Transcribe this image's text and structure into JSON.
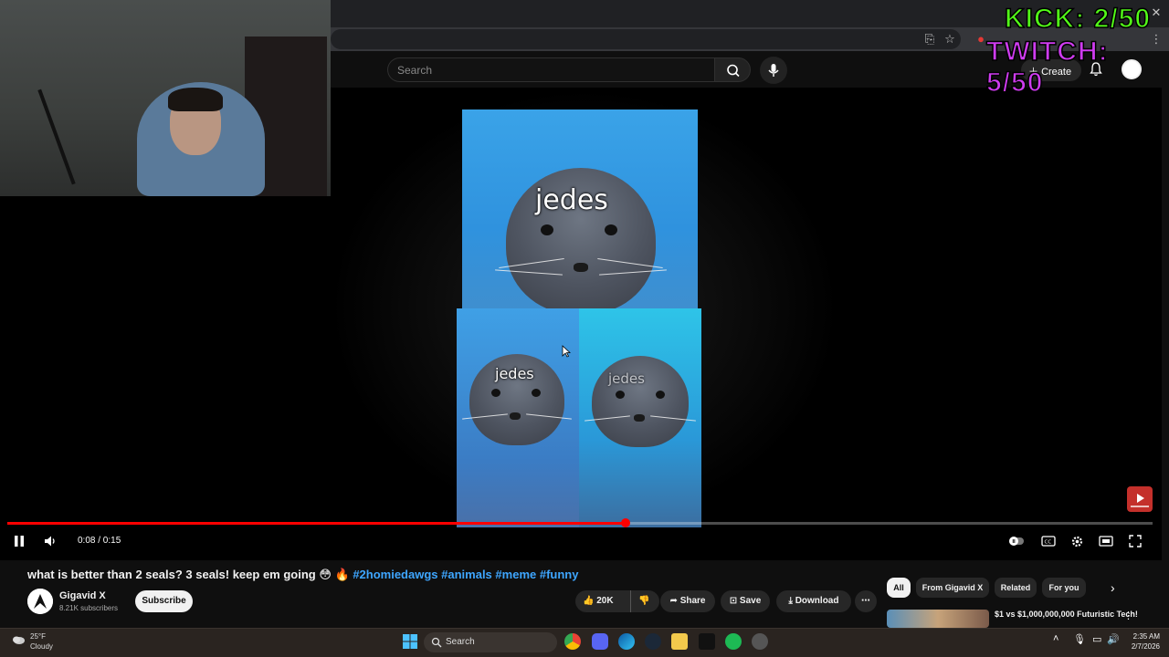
{
  "browser": {
    "icons": [
      "install-icon",
      "star-icon",
      "extension-icon",
      "extension-icon",
      "extension-icon",
      "puzzle-icon",
      "menu-dots-icon"
    ]
  },
  "header": {
    "search_placeholder": "Search",
    "create_label": "Create"
  },
  "overlays": {
    "kick_counter": "KICK: 2/50",
    "twitch_counter": "TWITCH: 5/50",
    "kick_color": "#53fc18",
    "twitch_color": "#cf3cf0"
  },
  "video_frame": {
    "caption_top": "jedes",
    "caption_left": "jedes",
    "caption_right": "jedes"
  },
  "player": {
    "time": "0:08 / 0:15",
    "progress": 0.54,
    "accent": "#ff0000"
  },
  "video": {
    "title_text": "what is better than 2 seals? 3 seals! keep em going 😳 🔥",
    "hashtags": [
      "#2homiedawgs",
      "#animals",
      "#meme",
      "#funny"
    ]
  },
  "channel": {
    "name": "Gigavid X",
    "subscribers": "8.21K subscribers",
    "subscribe_label": "Subscribe"
  },
  "actions": {
    "likes": "20K",
    "share": "Share",
    "save": "Save",
    "download": "Download"
  },
  "chips": [
    "All",
    "From Gigavid X",
    "Related",
    "For you"
  ],
  "recommendation": {
    "title": "$1 vs $1,000,000,000 Futuristic Tech!"
  },
  "taskbar": {
    "weather_temp": "25°F",
    "weather_cond": "Cloudy",
    "search_label": "Search",
    "clock_time": "2:35 AM",
    "clock_date": "2/7/2026"
  }
}
